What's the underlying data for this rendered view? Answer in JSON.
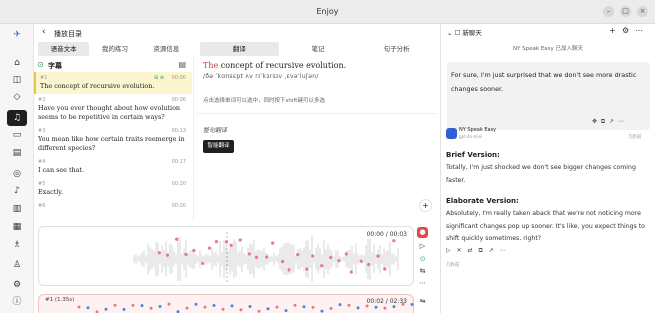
{
  "window": {
    "title": "Enjoy"
  },
  "breadcrumb": {
    "back": "‹",
    "label": "播放目录"
  },
  "left_tabs": [
    "语音文本",
    "我的练习",
    "资源信息"
  ],
  "transcript": {
    "header": "字幕",
    "segments": [
      {
        "index": "#1",
        "time": "00:00",
        "text": "The concept of recursive evolution.",
        "highlight": true,
        "extra": "⊞ ⊕"
      },
      {
        "index": "#2",
        "time": "00:06",
        "text": "Have you ever thought about how evolution seems to be repetitive in certain ways?"
      },
      {
        "index": "#3",
        "time": "00:13",
        "text": "You mean like how certain traits reemerge in different species?"
      },
      {
        "index": "#4",
        "time": "00:17",
        "text": "I can see that."
      },
      {
        "index": "#5",
        "time": "00:20",
        "text": "Exactly."
      },
      {
        "index": "#6",
        "time": "00:20",
        "text": ""
      }
    ]
  },
  "analysis": {
    "tabs": [
      "翻译",
      "笔记",
      "句子分析"
    ],
    "sentence_first": "The",
    "sentence_rest": " concept of recursive evolution.",
    "ipa": "/ðə   ˈkɑnsɛpt   ʌv   rɪˈkɜrsɪv   ˌɛvəˈluʃən/",
    "hint": "点击选择单词可以选中，同时按下shift键可以多选",
    "translation_label": "整句翻译",
    "translate_button": "智能翻译",
    "add": "+"
  },
  "waveform": {
    "time": "00:00 / 00:03"
  },
  "recording": {
    "label": "#1 (1.35s)",
    "time": "00:02 / 02:33"
  },
  "chat": {
    "title": "新聊天",
    "system_msg": "NY Speak Easy 已加入聊天",
    "user_msg": "For sure, I'm just surprised that we don't see more drastic changes sooner.",
    "user_ago": "几秒前",
    "bot_name": "NY Speak Easy",
    "bot_sub": "gpt-4o-mini",
    "brief_title": "Brief Version:",
    "brief_text": "Totally, I'm just shocked we don't see bigger changes coming faster.",
    "elab_title": "Elaborate Version:",
    "elab_text": "Absolutely, I'm really taken aback that we're not noticing more significant changes pop up sooner. It's like, you expect things to shift quickly sometimes, right?",
    "bot_ago": "几秒前"
  }
}
